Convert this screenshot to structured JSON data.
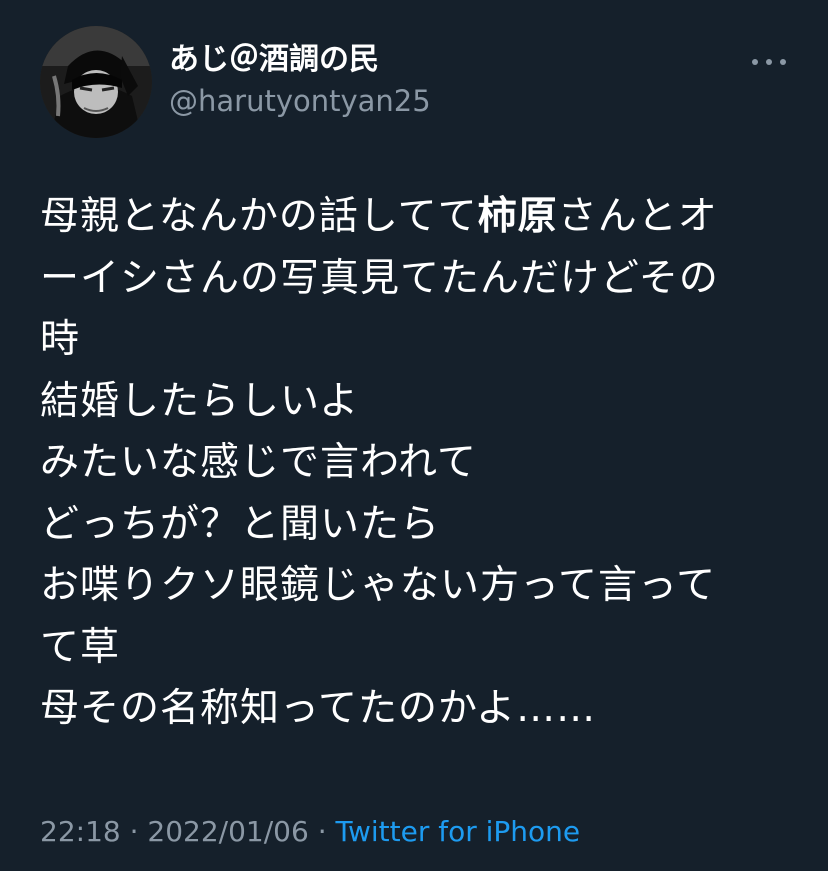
{
  "colors": {
    "background": "#15202b",
    "text": "#ffffff",
    "muted": "#8b98a5",
    "link": "#1d9bf0"
  },
  "author": {
    "display_name": "あじ＠酒調の民",
    "handle": "@harutyontyan25"
  },
  "icons": {
    "more": "more-horizontal-icon"
  },
  "tweet": {
    "lines": [
      {
        "before": "母親となんかの話してて",
        "bold": "柿原",
        "after": "さんとオ"
      },
      {
        "text": "ーイシさんの写真見てたんだけどその"
      },
      {
        "text": "時"
      },
      {
        "text": "結婚したらしいよ"
      },
      {
        "text": "みたいな感じで言われて"
      },
      {
        "text": "どっちが？と聞いたら"
      },
      {
        "text": "お喋りクソ眼鏡じゃない方って言って"
      },
      {
        "text": "て草"
      },
      {
        "text": "母その名称知ってたのかよ……"
      }
    ]
  },
  "meta": {
    "time": "22:18",
    "separator1": " · ",
    "date": "2022/01/06",
    "separator2": " · ",
    "source": "Twitter for iPhone"
  }
}
